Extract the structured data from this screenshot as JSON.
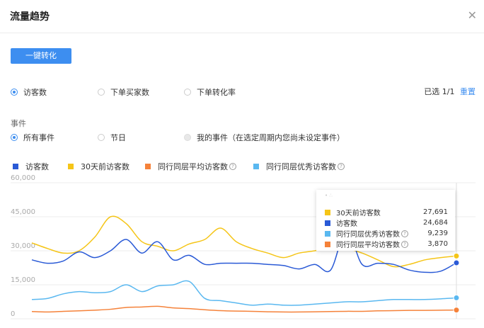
{
  "header": {
    "title": "流量趋势",
    "close_icon": "close-icon"
  },
  "convert_button": "一键转化",
  "metrics": {
    "options": [
      {
        "label": "访客数",
        "selected": true
      },
      {
        "label": "下单买家数",
        "selected": false
      },
      {
        "label": "下单转化率",
        "selected": false
      }
    ],
    "selected_count": "已选 1/1",
    "reset": "重置"
  },
  "events": {
    "label": "事件",
    "options": [
      {
        "label": "所有事件",
        "selected": true
      },
      {
        "label": "节日",
        "selected": false
      },
      {
        "label": "我的事件（在选定周期内您尚未设定事件）",
        "selected": false,
        "disabled": true
      }
    ]
  },
  "legend": [
    {
      "label": "访客数",
      "color": "#2a5ad6",
      "help": false
    },
    {
      "label": "30天前访客数",
      "color": "#f5c518",
      "help": false
    },
    {
      "label": "同行同层平均访客数",
      "color": "#f5823a",
      "help": true
    },
    {
      "label": "同行同层优秀访客数",
      "color": "#5ab8f0",
      "help": true
    }
  ],
  "tooltip": {
    "rows": [
      {
        "label": "30天前访客数",
        "value": "27,691",
        "color": "#f5c518"
      },
      {
        "label": "访客数",
        "value": "24,684",
        "color": "#2a5ad6"
      },
      {
        "label": "同行同层优秀访客数",
        "value": "9,239",
        "color": "#5ab8f0"
      },
      {
        "label": "同行同层平均访客数",
        "value": "3,870",
        "color": "#f5823a"
      }
    ]
  },
  "chart_data": {
    "type": "line",
    "y_ticks": [
      "60,000",
      "45,000",
      "30,000",
      "15,000",
      "0"
    ],
    "ylim": [
      0,
      60000
    ],
    "series": [
      {
        "name": "30天前访客数",
        "color": "#f5c518",
        "values": [
          33500,
          31000,
          29000,
          30000,
          36000,
          45000,
          42000,
          34000,
          32000,
          30000,
          33000,
          35000,
          40000,
          34000,
          31000,
          29000,
          27000,
          29000,
          30000,
          31500,
          31000,
          29000,
          26000,
          23000,
          24000,
          26000,
          27000,
          27691
        ]
      },
      {
        "name": "访客数",
        "color": "#2a5ad6",
        "values": [
          26000,
          24500,
          25500,
          29500,
          27000,
          30000,
          35000,
          29000,
          34000,
          26000,
          28000,
          24000,
          24500,
          24500,
          24500,
          24000,
          23500,
          22000,
          24000,
          21500,
          39000,
          24000,
          24500,
          24000,
          21500,
          20500,
          21000,
          24684
        ]
      },
      {
        "name": "同行同层优秀访客数",
        "color": "#5ab8f0",
        "values": [
          8500,
          9000,
          11000,
          12000,
          11500,
          12000,
          15000,
          12000,
          14500,
          15000,
          16500,
          9000,
          8000,
          7000,
          6000,
          6500,
          6000,
          6000,
          6500,
          7000,
          7500,
          7500,
          8000,
          8500,
          8500,
          8500,
          8800,
          9239
        ]
      },
      {
        "name": "同行同层平均访客数",
        "color": "#f5823a",
        "values": [
          3200,
          3000,
          3300,
          3500,
          3800,
          4200,
          5000,
          5200,
          5500,
          4800,
          4500,
          4000,
          3600,
          3400,
          3300,
          3100,
          3000,
          3000,
          3100,
          3200,
          3300,
          3300,
          3500,
          3600,
          3700,
          3700,
          3800,
          3870
        ]
      }
    ]
  }
}
